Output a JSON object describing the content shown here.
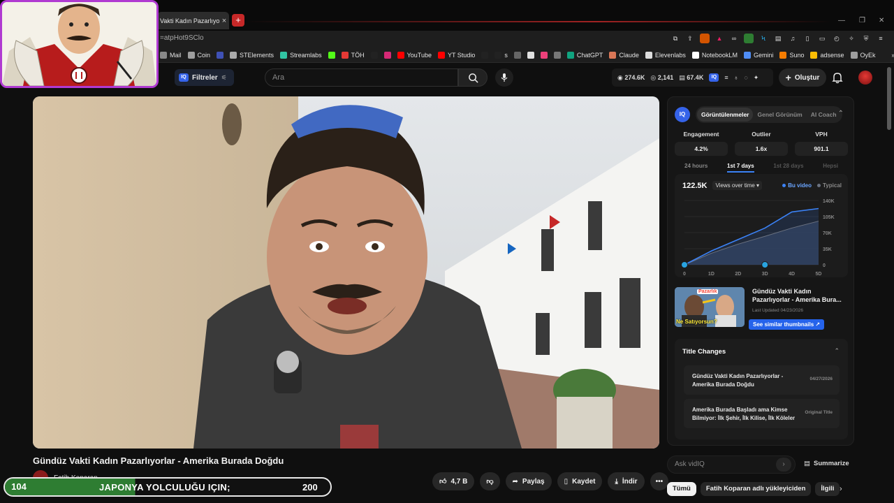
{
  "browser": {
    "tab_title": "Vakti Kadın Pazarlıyorl",
    "tab_close": "×",
    "new_tab": "+",
    "url": "=atpHot9SClo",
    "window_min": "—",
    "window_max": "❐",
    "window_close": "✕",
    "bookmarks": [
      {
        "label": "Mail",
        "icon": "mail-icon",
        "color": "#888888"
      },
      {
        "label": "Coin",
        "icon": "folder-icon",
        "color": "#9e9e9e"
      },
      {
        "label": "",
        "icon": "r-icon",
        "color": "#3f51b5"
      },
      {
        "label": "STElements",
        "icon": "st-icon",
        "color": "#aaaaaa"
      },
      {
        "label": "Streamlabs",
        "icon": "streamlabs-icon",
        "color": "#31c3a2"
      },
      {
        "label": "",
        "icon": "kick-icon",
        "color": "#53fc18"
      },
      {
        "label": "TÖH",
        "icon": "toh-icon",
        "color": "#e53935"
      },
      {
        "label": "",
        "icon": "x-icon",
        "color": "#222222"
      },
      {
        "label": "",
        "icon": "instagram-icon",
        "color": "#d62976"
      },
      {
        "label": "YouTube",
        "icon": "youtube-icon",
        "color": "#ff0000"
      },
      {
        "label": "YT Studio",
        "icon": "yt-studio-icon",
        "color": "#ff0000"
      },
      {
        "label": "",
        "icon": "tiktok-icon",
        "color": "#222222"
      },
      {
        "label": "s",
        "icon": "tiktok-studio-icon",
        "color": "#222222"
      },
      {
        "label": "",
        "icon": "dot-icon",
        "color": "#666666"
      },
      {
        "label": "",
        "icon": "k-icon",
        "color": "#e0e0e0"
      },
      {
        "label": "",
        "icon": "pink-icon",
        "color": "#ec407a"
      },
      {
        "label": "",
        "icon": "sliders-icon",
        "color": "#777777"
      },
      {
        "label": "ChatGPT",
        "icon": "chatgpt-icon",
        "color": "#10a37f"
      },
      {
        "label": "Claude",
        "icon": "claude-icon",
        "color": "#d97757"
      },
      {
        "label": "Elevenlabs",
        "icon": "elevenlabs-icon",
        "color": "#dddddd"
      },
      {
        "label": "NotebookLM",
        "icon": "notebooklm-icon",
        "color": "#ffffff"
      },
      {
        "label": "Gemini",
        "icon": "gemini-icon",
        "color": "#4f8df5"
      },
      {
        "label": "Suno",
        "icon": "suno-icon",
        "color": "#f57c00"
      },
      {
        "label": "adsense",
        "icon": "adsense-icon",
        "color": "#fbbc04"
      },
      {
        "label": "OyEk",
        "icon": "oyek-icon",
        "color": "#9e9e9e"
      },
      {
        "label": "»",
        "icon": "more-bookmarks-icon",
        "color": "#1e1e1e"
      }
    ]
  },
  "header": {
    "filters_label": "Filtreler",
    "iq_badge": "IQ",
    "search_placeholder": "Ara",
    "stats": {
      "subs": "274.6K",
      "views": "2,141",
      "other": "67.4K"
    },
    "create_label": "Oluştur"
  },
  "video": {
    "title": "Gündüz Vakti Kadın Pazarlıyorlar - Amerika Burada Doğdu",
    "channel": "Fatih Koparan",
    "likes": "4,7 B",
    "share": "Paylaş",
    "save": "Kaydet",
    "download": "İndir"
  },
  "ticker": {
    "left": "104",
    "text": "JAPONYA YOLCULUĞU IÇIN;",
    "right": "200"
  },
  "vidiq": {
    "logo": "IQ",
    "tabs": [
      "Görüntülenmeler",
      "Genel Görünüm",
      "AI Coach"
    ],
    "active_tab": 0,
    "metrics": [
      {
        "label": "Engagement",
        "value": "4.2%"
      },
      {
        "label": "Outlier",
        "value": "1.6x"
      },
      {
        "label": "VPH",
        "value": "901.1"
      }
    ],
    "periods": [
      "24 hours",
      "1st 7 days",
      "1st 28 days",
      "Hepsi"
    ],
    "active_period": 1,
    "chart_total": "122.5K",
    "chart_dropdown": "Views over time",
    "legend_this": "Bu video",
    "legend_typical": "Typical",
    "colors": {
      "this": "#3b82f6",
      "typical": "#6b7280",
      "band": "#2f3645"
    },
    "similar": {
      "title": "Gündüz Vakti Kadın Pazarlıyorlar - Amerika Bura...",
      "updated": "Last Updated 04/23/2026",
      "button": "See similar thumbnails ↗",
      "thumb_text": "Ne Satıyorsun?",
      "thumb_tag": "Pazarlık"
    },
    "title_changes": {
      "heading": "Title Changes",
      "items": [
        {
          "title": "Gündüz Vakti Kadın Pazarlıyorlar - Amerika Burada Doğdu",
          "meta": "04/27/2026"
        },
        {
          "title": "Amerika Burada Başladı ama Kimse Bilmiyor: İlk Şehir, İlk Kilise, İlk Köleler",
          "meta": "Original Title"
        }
      ]
    },
    "ask_placeholder": "Ask vidIQ",
    "ask_send": "›",
    "summarize": "Summarize"
  },
  "chips": [
    "Tümü",
    "Fatih Koparan adlı yükleyiciden",
    "İlgili"
  ],
  "chips_next": "›",
  "chart_data": {
    "type": "line",
    "title": "",
    "x": [
      "0",
      "1D",
      "2D",
      "3D",
      "4D",
      "5D"
    ],
    "xlabel": "",
    "ylabel": "",
    "ylim": [
      0,
      140000
    ],
    "yticks": [
      "140K",
      "105K",
      "70K",
      "35K",
      "0"
    ],
    "series": [
      {
        "name": "Bu video",
        "values": [
          0,
          30000,
          55000,
          80000,
          115000,
          122500
        ]
      },
      {
        "name": "Typical",
        "values": [
          0,
          25000,
          45000,
          62000,
          80000,
          95000
        ]
      }
    ],
    "grid": true,
    "legend": "top-right"
  }
}
